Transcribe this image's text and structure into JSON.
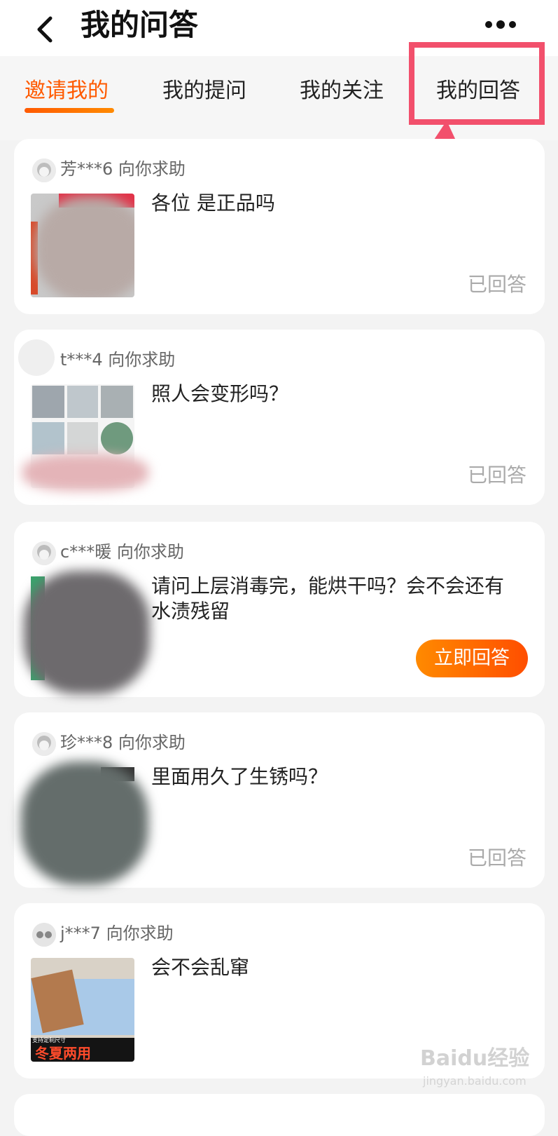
{
  "header": {
    "title": "我的问答"
  },
  "tabs": [
    {
      "label": "邀请我的",
      "active": true
    },
    {
      "label": "我的提问",
      "active": false
    },
    {
      "label": "我的关注",
      "active": false
    },
    {
      "label": "我的回答",
      "active": false
    }
  ],
  "colors": {
    "accent": "#ff5a00",
    "annotation": "#f2506c"
  },
  "cards": [
    {
      "user": "芳***6 向你求助",
      "question": "各位 是正品吗",
      "status": "已回答"
    },
    {
      "user": "t***4 向你求助",
      "question": "照人会变形吗？",
      "status": "已回答"
    },
    {
      "user": "c***暖 向你求助",
      "question": "请问上层消毒完，能烘干吗？会不会还有水渍残留",
      "action": "立即回答"
    },
    {
      "user": "珍***8 向你求助",
      "question": "里面用久了生锈吗？",
      "status": "已回答"
    },
    {
      "user": "j***7 向你求助",
      "question": "会不会乱窜",
      "thumb_caption_small": "支持定制尺寸",
      "thumb_caption": "冬夏两用"
    }
  ],
  "watermark": {
    "text": "Baidu经验",
    "sub": "jingyan.baidu.com"
  }
}
